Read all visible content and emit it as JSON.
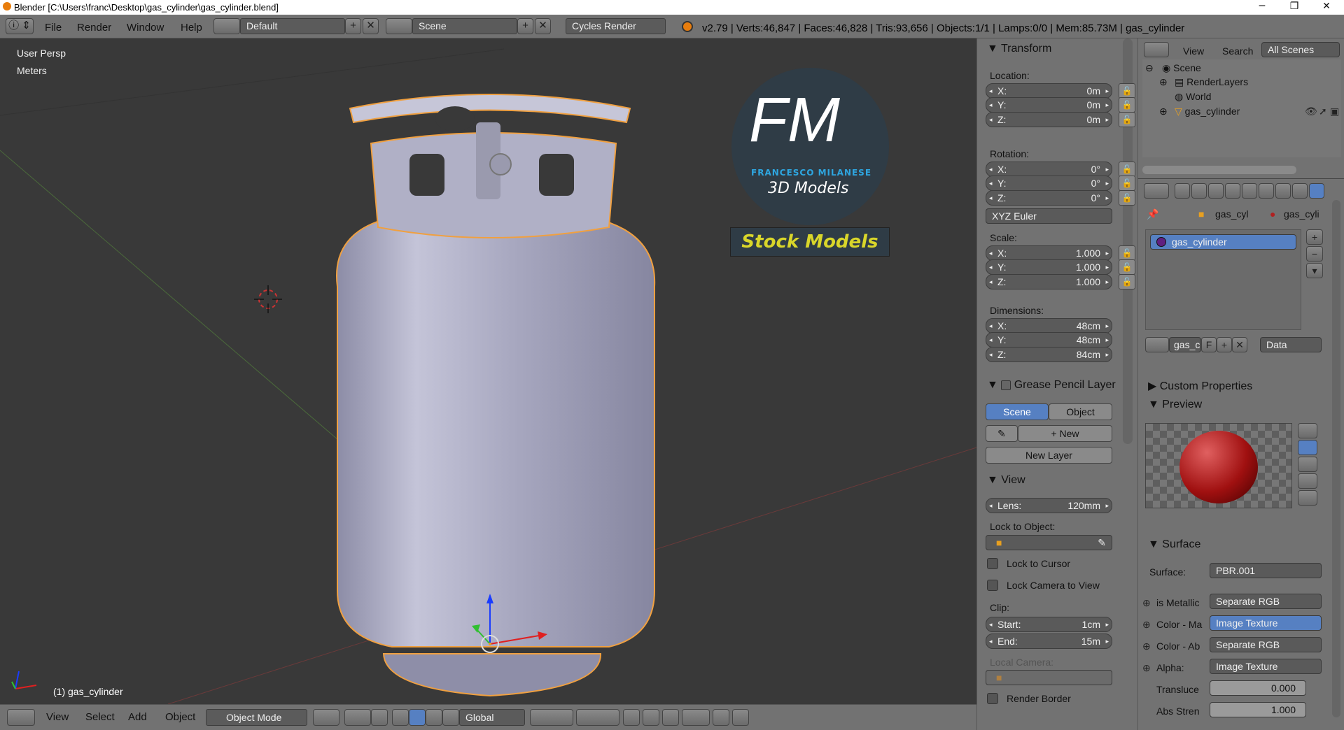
{
  "window": {
    "title": "Blender  [C:\\Users\\franc\\Desktop\\gas_cylinder\\gas_cylinder.blend]",
    "minimize": "─",
    "maximize": "❐",
    "close": "✕"
  },
  "info_header": {
    "menus": [
      "File",
      "Render",
      "Window",
      "Help"
    ],
    "screen_layout": "Default",
    "scene": "Scene",
    "render_engine": "Cycles Render",
    "stats": "v2.79 | Verts:46,847 | Faces:46,828 | Tris:93,656 | Objects:1/1 | Lamps:0/0 | Mem:85.73M | gas_cylinder"
  },
  "viewport": {
    "view_name": "User Persp",
    "units": "Meters",
    "object_label": "(1) gas_cylinder",
    "logo": {
      "letters": "FM",
      "line1": "FRANCESCO MILANESE",
      "line2": "3D Models",
      "banner": "Stock Models"
    }
  },
  "bottom_header": {
    "menus": [
      "View",
      "Select",
      "Add",
      "Object"
    ],
    "mode": "Object Mode",
    "orientation": "Global"
  },
  "n_panel": {
    "transform": {
      "title": "Transform",
      "location_label": "Location:",
      "location": [
        {
          "k": "X:",
          "v": "0m"
        },
        {
          "k": "Y:",
          "v": "0m"
        },
        {
          "k": "Z:",
          "v": "0m"
        }
      ],
      "rotation_label": "Rotation:",
      "rotation": [
        {
          "k": "X:",
          "v": "0°"
        },
        {
          "k": "Y:",
          "v": "0°"
        },
        {
          "k": "Z:",
          "v": "0°"
        }
      ],
      "rotation_mode": "XYZ Euler",
      "scale_label": "Scale:",
      "scale": [
        {
          "k": "X:",
          "v": "1.000"
        },
        {
          "k": "Y:",
          "v": "1.000"
        },
        {
          "k": "Z:",
          "v": "1.000"
        }
      ],
      "dimensions_label": "Dimensions:",
      "dimensions": [
        {
          "k": "X:",
          "v": "48cm"
        },
        {
          "k": "Y:",
          "v": "48cm"
        },
        {
          "k": "Z:",
          "v": "84cm"
        }
      ]
    },
    "grease_pencil": {
      "title": "Grease Pencil Layer",
      "tab_scene": "Scene",
      "tab_object": "Object",
      "new": "New",
      "new_layer": "New Layer"
    },
    "view": {
      "title": "View",
      "lens_label": "Lens:",
      "lens": "120mm",
      "lock_object_label": "Lock to Object:",
      "lock_cursor": "Lock to Cursor",
      "lock_camera": "Lock Camera to View",
      "clip_label": "Clip:",
      "clip_start_label": "Start:",
      "clip_start": "1cm",
      "clip_end_label": "End:",
      "clip_end": "15m",
      "local_camera_label": "Local Camera:",
      "render_border": "Render Border"
    }
  },
  "outliner": {
    "menus": [
      "View",
      "Search"
    ],
    "filter": "All Scenes",
    "items": [
      "Scene",
      "RenderLayers",
      "World",
      "gas_cylinder"
    ]
  },
  "properties": {
    "breadcrumb": [
      "gas_cyl",
      "gas_cyli"
    ],
    "material_slot": "gas_cylinder",
    "material_name": "gas_c",
    "fake_user": "F",
    "link": "Data",
    "custom_properties": "Custom Properties",
    "preview": "Preview",
    "surface_title": "Surface",
    "surface_label": "Surface:",
    "surface_value": "PBR.001",
    "inputs": [
      {
        "label": "is Metallic",
        "value": "Separate RGB"
      },
      {
        "label": "Color - Ma",
        "value": "Image Texture"
      },
      {
        "label": "Color - Ab",
        "value": "Separate RGB"
      },
      {
        "label": "Alpha:",
        "value": "Image Texture"
      }
    ],
    "translucency_label": "Transluce",
    "translucency": "0.000",
    "abs_strength_label": "Abs Stren",
    "abs_strength": "1.000"
  },
  "colors": {
    "header": "#727272",
    "viewport": "#393939",
    "selected_blue": "#5680c2",
    "outline_orange": "#f0a040"
  }
}
